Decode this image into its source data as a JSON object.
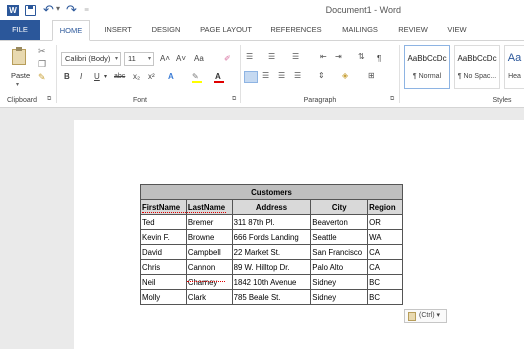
{
  "title_bar": {
    "document_title": "Document1 - Word",
    "quick_access": [
      "word-app-icon",
      "save-icon",
      "undo-icon",
      "redo-icon",
      "customize-icon"
    ]
  },
  "tabs": [
    "FILE",
    "HOME",
    "INSERT",
    "DESIGN",
    "PAGE LAYOUT",
    "REFERENCES",
    "MAILINGS",
    "REVIEW",
    "VIEW"
  ],
  "active_tab": "HOME",
  "ribbon": {
    "clipboard": {
      "paste_label": "Paste",
      "group_label": "Clipboard"
    },
    "font": {
      "font_name": "Calibri (Body)",
      "font_size": "11",
      "grow": "A˄",
      "shrink": "A˅",
      "change_case": "Aa",
      "bold": "B",
      "italic": "I",
      "underline": "U",
      "strike": "abc",
      "subscript": "x₂",
      "superscript": "x²",
      "text_effects": "A",
      "font_color": "A",
      "group_label": "Font"
    },
    "paragraph": {
      "pilcrow": "¶",
      "group_label": "Paragraph"
    },
    "styles": {
      "items": [
        {
          "sample": "AaBbCcDc",
          "name": "¶ Normal"
        },
        {
          "sample": "AaBbCcDc",
          "name": "¶ No Spac..."
        },
        {
          "sample": "Aa",
          "name": "Hea"
        }
      ],
      "group_label": "Styles"
    }
  },
  "table": {
    "caption": "Customers",
    "headers": [
      "FirstName",
      "LastName",
      "Address",
      "City",
      "Region"
    ],
    "rows": [
      [
        "Ted",
        "Bremer",
        "311 87th Pl.",
        "Beaverton",
        "OR"
      ],
      [
        "Kevin F.",
        "Browne",
        "666 Fords Landing",
        "Seattle",
        "WA"
      ],
      [
        "David",
        "Campbell",
        "22 Market St.",
        "San Francisco",
        "CA"
      ],
      [
        "Chris",
        "Cannon",
        "89 W. Hilltop Dr.",
        "Palo Alto",
        "CA"
      ],
      [
        "Neil",
        "Charney",
        "1842 10th Avenue",
        "Sidney",
        "BC"
      ],
      [
        "Molly",
        "Clark",
        "785 Beale St.",
        "Sidney",
        "BC"
      ]
    ]
  },
  "paste_options": {
    "label": "(Ctrl) ▾"
  },
  "colors": {
    "accent": "#2b579a",
    "table_header": "#d9d9d9",
    "table_caption": "#bfbfbf"
  }
}
